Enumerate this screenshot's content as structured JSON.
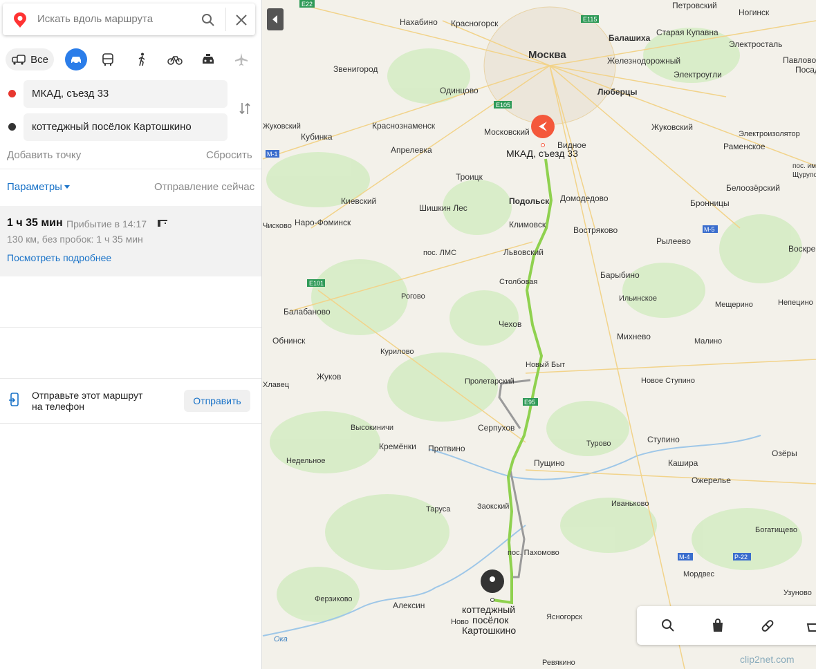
{
  "search": {
    "placeholder": "Искать вдоль маршрута"
  },
  "modes": {
    "all_label": "Все"
  },
  "points": {
    "from": "МКАД, съезд 33",
    "to": "коттеджный посёлок Картошкино"
  },
  "actions": {
    "add_point": "Добавить точку",
    "reset": "Сбросить",
    "params": "Параметры",
    "departure": "Отправление сейчас"
  },
  "route": {
    "duration": "1 ч 35 мин",
    "arrival": "Прибытие в 14:17",
    "details": "130 км, без пробок: 1 ч 35 мин",
    "more_link": "Посмотреть подробнее"
  },
  "send": {
    "text_line1": "Отправьте этот маршрут",
    "text_line2": "на телефон",
    "button": "Отправить"
  },
  "map": {
    "start_label": "МКАД, съезд 33",
    "end_label": [
      "коттеджный",
      "посёлок",
      "Картошкино"
    ],
    "place_labels": [
      "Москва",
      "Нахабино",
      "Красногорск",
      "Петровский",
      "Ногинск",
      "Балашиха",
      "Старая Купавна",
      "Звенигород",
      "Электросталь",
      "Павлово",
      "Посад",
      "Железнодорожный",
      "Электроугли",
      "Одинцово",
      "Люберцы",
      "Кубинка",
      "Краснознаменск",
      "Московский",
      "Видное",
      "Жуковский",
      "Электроизолятор",
      "Раменское",
      "Апрелевка",
      "Троицк",
      "пос. им",
      "Щурупов",
      "Белоозёрский",
      "Киевский",
      "Шишкин Лес",
      "Подольск",
      "Домодедово",
      "Бронницы",
      "Наро-Фоминск",
      "Климовск",
      "Востряково",
      "Рылеево",
      "Воскре",
      "пос. ЛМС",
      "Львовский",
      "Столбовая",
      "Барыбино",
      "Рогово",
      "Ильинское",
      "Мещерино",
      "Непецино",
      "Балабаново",
      "Чехов",
      "Михнево",
      "Малино",
      "Обнинск",
      "Курилово",
      "Новый Быт",
      "Жуков",
      "Пролетарский",
      "Новое Ступино",
      "Высокиничи",
      "Серпухов",
      "Турово",
      "Ступино",
      "Озёры",
      "Кремёнки",
      "Протвино",
      "Пущино",
      "Кашира",
      "Недельное",
      "Ожерелье",
      "Таруса",
      "Заокский",
      "Иваньково",
      "Богатищево",
      "пос. Пахомово",
      "Мордвес",
      "Ферзиково",
      "Алексин",
      "Ясногорск",
      "Узуново",
      "Ока",
      "Ревякино",
      "Ново",
      "Петровский",
      "Кубинка",
      "Жуковский",
      "Чисково",
      "Хлавец"
    ],
    "road_labels": [
      "E22",
      "E115",
      "E105",
      "M-1",
      "E101",
      "M-5",
      "M-4",
      "P-22",
      "E95"
    ]
  },
  "watermark": "clip2net.com",
  "colors": {
    "accent": "#2b7de9",
    "route": "#8fd14f",
    "start_pin": "#f4583b",
    "end_pin": "#333333"
  }
}
